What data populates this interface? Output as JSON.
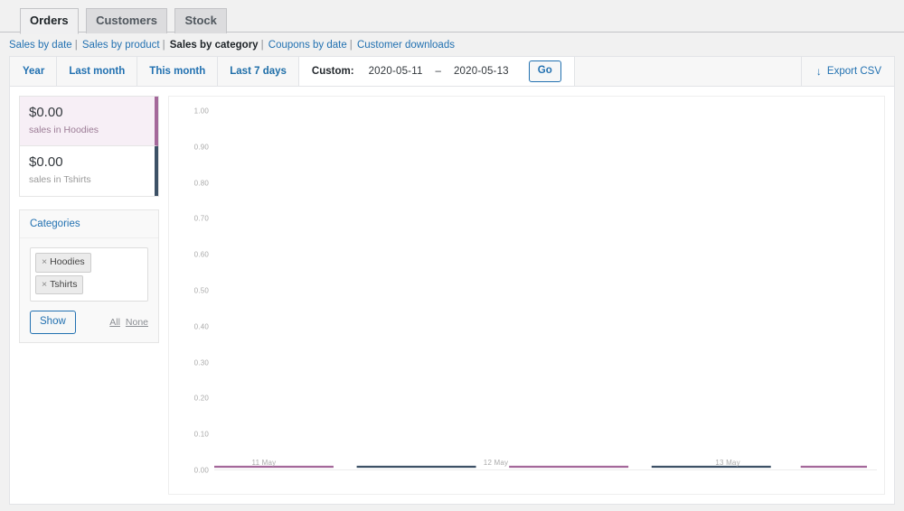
{
  "tabs": [
    {
      "label": "Orders",
      "active": true
    },
    {
      "label": "Customers",
      "active": false
    },
    {
      "label": "Stock",
      "active": false
    }
  ],
  "subnav": [
    {
      "label": "Sales by date",
      "current": false
    },
    {
      "label": "Sales by product",
      "current": false
    },
    {
      "label": "Sales by category",
      "current": true
    },
    {
      "label": "Coupons by date",
      "current": false
    },
    {
      "label": "Customer downloads",
      "current": false
    }
  ],
  "subnav_separator": "|",
  "toolbar": {
    "periods": [
      {
        "label": "Year",
        "active": false
      },
      {
        "label": "Last month",
        "active": false
      },
      {
        "label": "This month",
        "active": false
      },
      {
        "label": "Last 7 days",
        "active": true
      }
    ],
    "custom_label": "Custom:",
    "date_from": "2020-05-11",
    "date_separator": "–",
    "date_to": "2020-05-13",
    "go_label": "Go",
    "export_label": "Export CSV",
    "export_icon": "download-arrow-icon"
  },
  "sidebar": {
    "legend": [
      {
        "amount": "$0.00",
        "label": "sales in Hoodies",
        "color": "#a4689a",
        "highlighted": true
      },
      {
        "amount": "$0.00",
        "label": "sales in Tshirts",
        "color": "#3d5166",
        "highlighted": false
      }
    ],
    "widget": {
      "title": "Categories",
      "chips": [
        {
          "remove_icon": "×",
          "label": "Hoodies"
        },
        {
          "remove_icon": "×",
          "label": "Tshirts"
        }
      ],
      "show_label": "Show",
      "all_label": "All",
      "none_label": "None"
    }
  },
  "chart_data": {
    "type": "line",
    "title": "Sales by category",
    "xlabel": "",
    "ylabel": "",
    "grid": false,
    "legend_position": "left-sidebar",
    "ylim": [
      0,
      1
    ],
    "ytick_labels": [
      "1.00",
      "0.90",
      "0.80",
      "0.70",
      "0.60",
      "0.50",
      "0.40",
      "0.30",
      "0.20",
      "0.10",
      "0.00"
    ],
    "ytick_values": [
      1.0,
      0.9,
      0.8,
      0.7,
      0.6,
      0.5,
      0.4,
      0.3,
      0.2,
      0.1,
      0.0
    ],
    "x": [
      "11 May",
      "12 May",
      "13 May"
    ],
    "xtick_labels": [
      "11 May",
      "12 May",
      "13 May"
    ],
    "xtick_positions_pct": [
      7.5,
      42.5,
      77.5
    ],
    "series": [
      {
        "name": "sales in Hoodies",
        "color": "#a4689a",
        "values": [
          0,
          0,
          0
        ]
      },
      {
        "name": "sales in Tshirts",
        "color": "#3d5166",
        "values": [
          0,
          0,
          0
        ]
      }
    ],
    "baseline_segments": [
      {
        "series": "sales in Hoodies",
        "color": "#a4689a",
        "start_pct": 0.0,
        "end_pct": 18.0
      },
      {
        "series": "sales in Tshirts",
        "color": "#3d5166",
        "start_pct": 21.5,
        "end_pct": 39.5
      },
      {
        "series": "sales in Hoodies",
        "color": "#a4689a",
        "start_pct": 44.5,
        "end_pct": 62.5
      },
      {
        "series": "sales in Tshirts",
        "color": "#3d5166",
        "start_pct": 66.0,
        "end_pct": 84.0
      },
      {
        "series": "sales in Hoodies",
        "color": "#a4689a",
        "start_pct": 88.5,
        "end_pct": 98.5
      }
    ]
  }
}
